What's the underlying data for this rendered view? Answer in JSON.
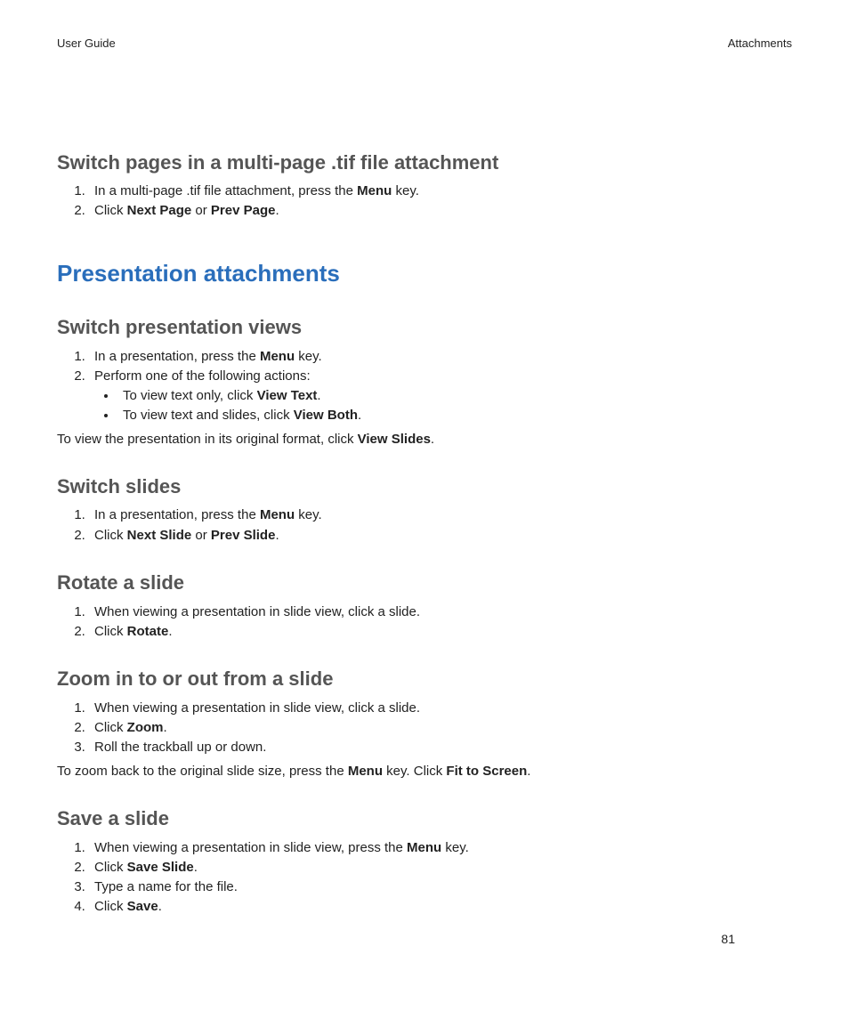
{
  "header": {
    "left": "User Guide",
    "right": "Attachments"
  },
  "tif": {
    "heading": "Switch pages in a multi-page .tif file attachment",
    "step1_pre": "In a multi-page .tif file attachment, press the ",
    "step1_bold": "Menu",
    "step1_post": " key.",
    "step2_pre": "Click ",
    "step2_bold1": "Next Page",
    "step2_mid": " or ",
    "step2_bold2": "Prev Page",
    "step2_post": "."
  },
  "chapter": "Presentation attachments",
  "views": {
    "heading": "Switch presentation views",
    "step1_pre": "In a presentation, press the ",
    "step1_bold": "Menu",
    "step1_post": " key.",
    "step2": "Perform one of the following actions:",
    "bullet1_pre": "To view text only, click ",
    "bullet1_bold": "View Text",
    "bullet1_post": ".",
    "bullet2_pre": "To view text and slides, click ",
    "bullet2_bold": "View Both",
    "bullet2_post": ".",
    "para_pre": "To view the presentation in its original format, click ",
    "para_bold": "View Slides",
    "para_post": "."
  },
  "switch_slides": {
    "heading": "Switch slides",
    "step1_pre": "In a presentation, press the ",
    "step1_bold": "Menu",
    "step1_post": " key.",
    "step2_pre": "Click ",
    "step2_bold1": "Next Slide",
    "step2_mid": " or ",
    "step2_bold2": "Prev Slide",
    "step2_post": "."
  },
  "rotate": {
    "heading": "Rotate a slide",
    "step1": "When viewing a presentation in slide view, click a slide.",
    "step2_pre": "Click ",
    "step2_bold": "Rotate",
    "step2_post": "."
  },
  "zoom": {
    "heading": "Zoom in to or out from a slide",
    "step1": "When viewing a presentation in slide view, click a slide.",
    "step2_pre": "Click ",
    "step2_bold": "Zoom",
    "step2_post": ".",
    "step3": "Roll the trackball up or down.",
    "para_pre": "To zoom back to the original slide size, press the ",
    "para_bold1": "Menu",
    "para_mid": " key. Click ",
    "para_bold2": "Fit to Screen",
    "para_post": "."
  },
  "save": {
    "heading": "Save a slide",
    "step1_pre": "When viewing a presentation in slide view, press the ",
    "step1_bold": "Menu",
    "step1_post": " key.",
    "step2_pre": "Click ",
    "step2_bold": "Save Slide",
    "step2_post": ".",
    "step3": "Type a name for the file.",
    "step4_pre": "Click ",
    "step4_bold": "Save",
    "step4_post": "."
  },
  "page_number": "81"
}
